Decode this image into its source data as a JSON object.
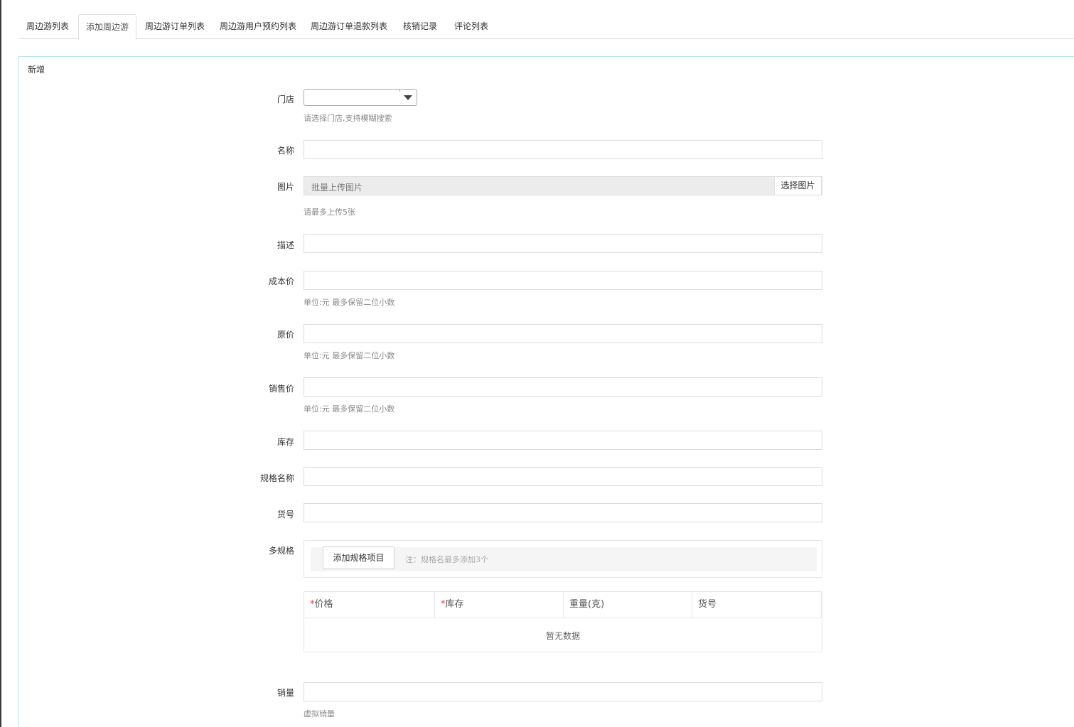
{
  "tabs": [
    {
      "label": "周边游列表"
    },
    {
      "label": "添加周边游"
    },
    {
      "label": "周边游订单列表"
    },
    {
      "label": "周边游用户预约列表"
    },
    {
      "label": "周边游订单退款列表"
    },
    {
      "label": "核销记录"
    },
    {
      "label": "评论列表"
    }
  ],
  "panel": {
    "title": "新增"
  },
  "form": {
    "store": {
      "label": "门店",
      "value": "",
      "help": "请选择门店,支持模糊搜索"
    },
    "name": {
      "label": "名称",
      "value": ""
    },
    "images": {
      "label": "图片",
      "placeholder": "批量上传图片",
      "button": "选择图片",
      "help": "请最多上传5张"
    },
    "description": {
      "label": "描述",
      "value": ""
    },
    "cost_price": {
      "label": "成本价",
      "value": "",
      "help": "单位:元 最多保留二位小数"
    },
    "original_price": {
      "label": "原价",
      "value": "",
      "help": "单位:元 最多保留二位小数"
    },
    "sale_price": {
      "label": "销售价",
      "value": "",
      "help": "单位:元 最多保留二位小数"
    },
    "stock": {
      "label": "库存",
      "value": ""
    },
    "spec_name": {
      "label": "规格名称",
      "value": ""
    },
    "sku": {
      "label": "货号",
      "value": ""
    },
    "multi_spec": {
      "label": "多规格",
      "add_button": "添加规格项目",
      "note": "注：规格名最多添加3个",
      "table": {
        "columns": [
          {
            "label": "价格",
            "required": "*"
          },
          {
            "label": "库存",
            "required": "*"
          },
          {
            "label": "重量(克)",
            "required": ""
          },
          {
            "label": "货号",
            "required": ""
          }
        ],
        "empty_text": "暂无数据"
      }
    },
    "sales": {
      "label": "销量",
      "value": "",
      "help": "虚拟销量"
    }
  },
  "colors": {
    "border": "#dcdcdc",
    "panel_border": "#bfe6ee",
    "required": "#e23b3b",
    "help": "#8a8a8a"
  }
}
